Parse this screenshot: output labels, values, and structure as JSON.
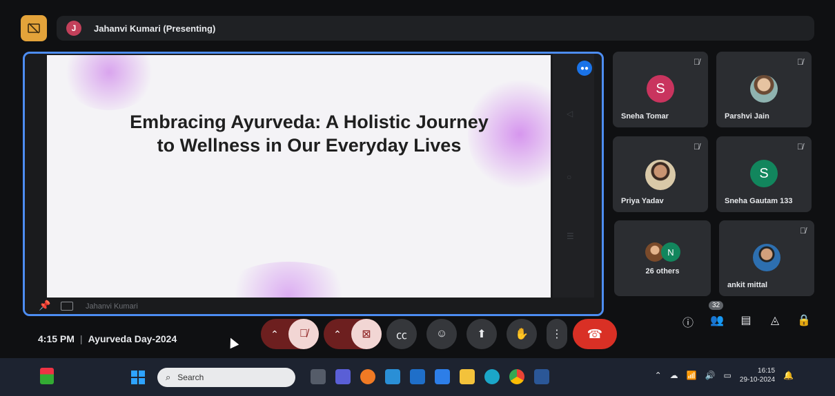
{
  "presenting": {
    "avatar_initial": "J",
    "text": "Jahanvi Kumari (Presenting)"
  },
  "slide": {
    "title": "Embracing Ayurveda: A Holistic Journey to Wellness in Our Everyday Lives",
    "presenter_label": "Jahanvi Kumari"
  },
  "participants": [
    {
      "name": "Sneha Tomar",
      "initial": "S",
      "color": "#c9345e",
      "muted": true
    },
    {
      "name": "Parshvi Jain",
      "initial": "",
      "muted": true
    },
    {
      "name": "Priya Yadav",
      "initial": "",
      "muted": true
    },
    {
      "name": "Sneha Gautam 133",
      "initial": "S",
      "color": "#12865d",
      "muted": true
    },
    {
      "name": "26 others",
      "initial": "N",
      "color": "#12865d"
    },
    {
      "name": "ankit mittal",
      "initial": "",
      "muted": true
    }
  ],
  "meeting": {
    "time": "4:15 PM",
    "title": "Ayurveda Day-2024",
    "people_count": "32"
  },
  "taskbar": {
    "search_placeholder": "Search",
    "clock_time": "16:15",
    "clock_date": "29-10-2024",
    "weather_badge": "1"
  },
  "colors": {
    "accent_blue": "#4d8df2",
    "leave_red": "#d93025",
    "muted_red": "#6d1f1f",
    "stop_present": "#e3a33a"
  }
}
